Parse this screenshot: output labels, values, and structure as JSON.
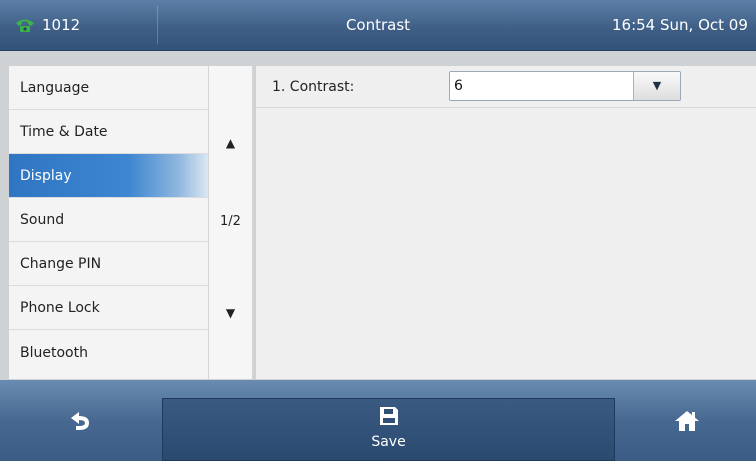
{
  "topbar": {
    "account": "1012",
    "title": "Contrast",
    "clock": "16:54 Sun, Oct 09"
  },
  "menu": {
    "items": [
      {
        "label": "Language"
      },
      {
        "label": "Time & Date"
      },
      {
        "label": "Display",
        "active": true
      },
      {
        "label": "Sound"
      },
      {
        "label": "Change PIN"
      },
      {
        "label": "Phone Lock"
      },
      {
        "label": "Bluetooth"
      }
    ]
  },
  "pager": {
    "up": "▲",
    "page": "1/2",
    "down": "▼"
  },
  "content": {
    "rows": [
      {
        "label": "1. Contrast:",
        "value": "6"
      }
    ]
  },
  "softkeys": {
    "back_icon": "back-arrow-icon",
    "save_label": "Save",
    "save_icon": "floppy-disk-icon",
    "home_icon": "home-icon"
  },
  "colors": {
    "bar_blue": "#476991",
    "active_item": "#2f75c2",
    "account_icon": "#3cb34a"
  }
}
